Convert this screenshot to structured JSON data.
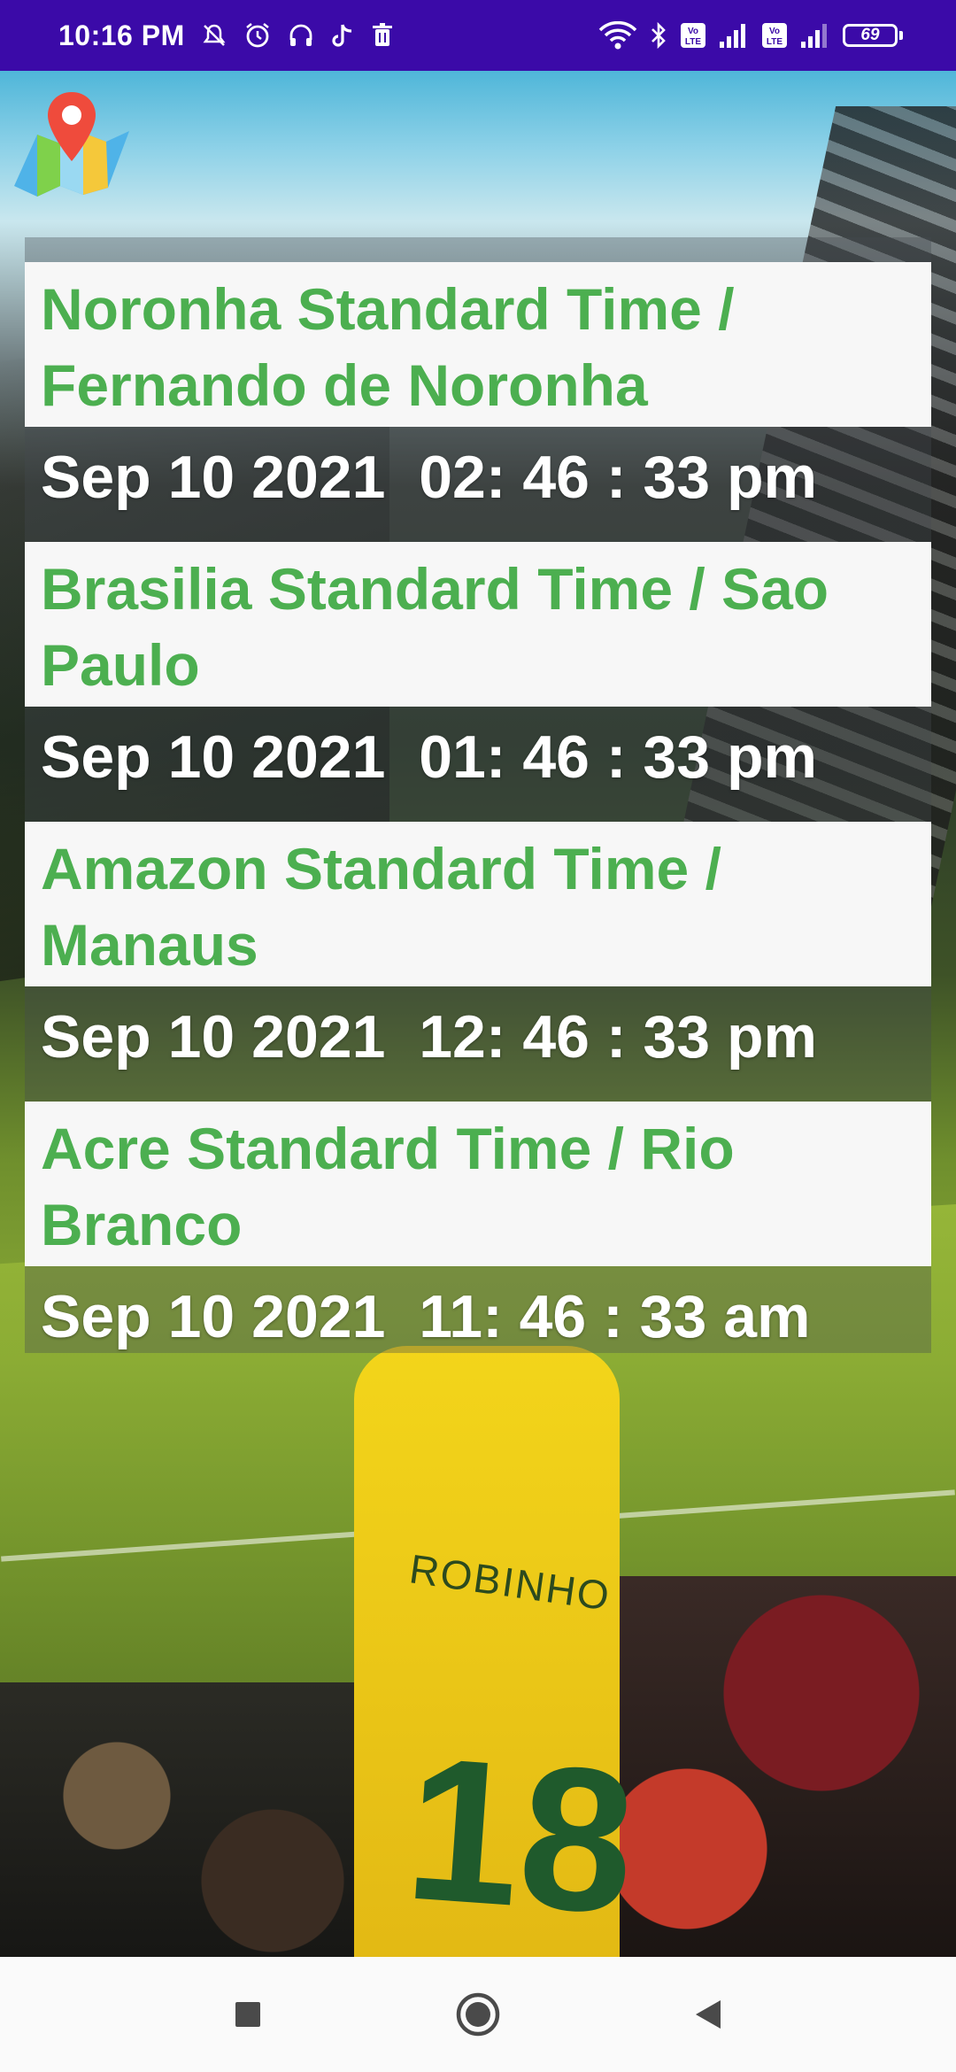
{
  "status_bar": {
    "time": "10:16 PM",
    "battery": "69",
    "left_icons": [
      "mute-icon",
      "alarm-icon",
      "headset-icon",
      "tiktok-icon",
      "trash-icon"
    ],
    "right_icons": [
      "wifi-icon",
      "bluetooth-icon",
      "volte-icon",
      "signal-icon",
      "volte-icon",
      "signal-icon",
      "battery-icon"
    ],
    "background_color": "#3b0aa8"
  },
  "app": {
    "logo_icon": "map-pin-icon",
    "name_color": "#4caf50",
    "time_color": "#ffffff"
  },
  "zones": [
    {
      "name": "Noronha Standard Time / Fernando de Noronha",
      "time": "Sep 10 2021  02: 46 : 33 pm"
    },
    {
      "name": "Brasilia Standard Time / Sao Paulo",
      "time": "Sep 10 2021  01: 46 : 33 pm"
    },
    {
      "name": "Amazon Standard Time / Manaus",
      "time": "Sep 10 2021  12: 46 : 33 pm"
    },
    {
      "name": "Acre Standard Time / Rio Branco",
      "time": "Sep 10 2021  11: 46 : 33 am"
    }
  ],
  "background_photo": {
    "jersey_name": "ROBINHO",
    "jersey_number": "18"
  },
  "nav_bar": {
    "buttons": [
      "recents-square-icon",
      "home-circle-icon",
      "back-triangle-icon"
    ]
  }
}
